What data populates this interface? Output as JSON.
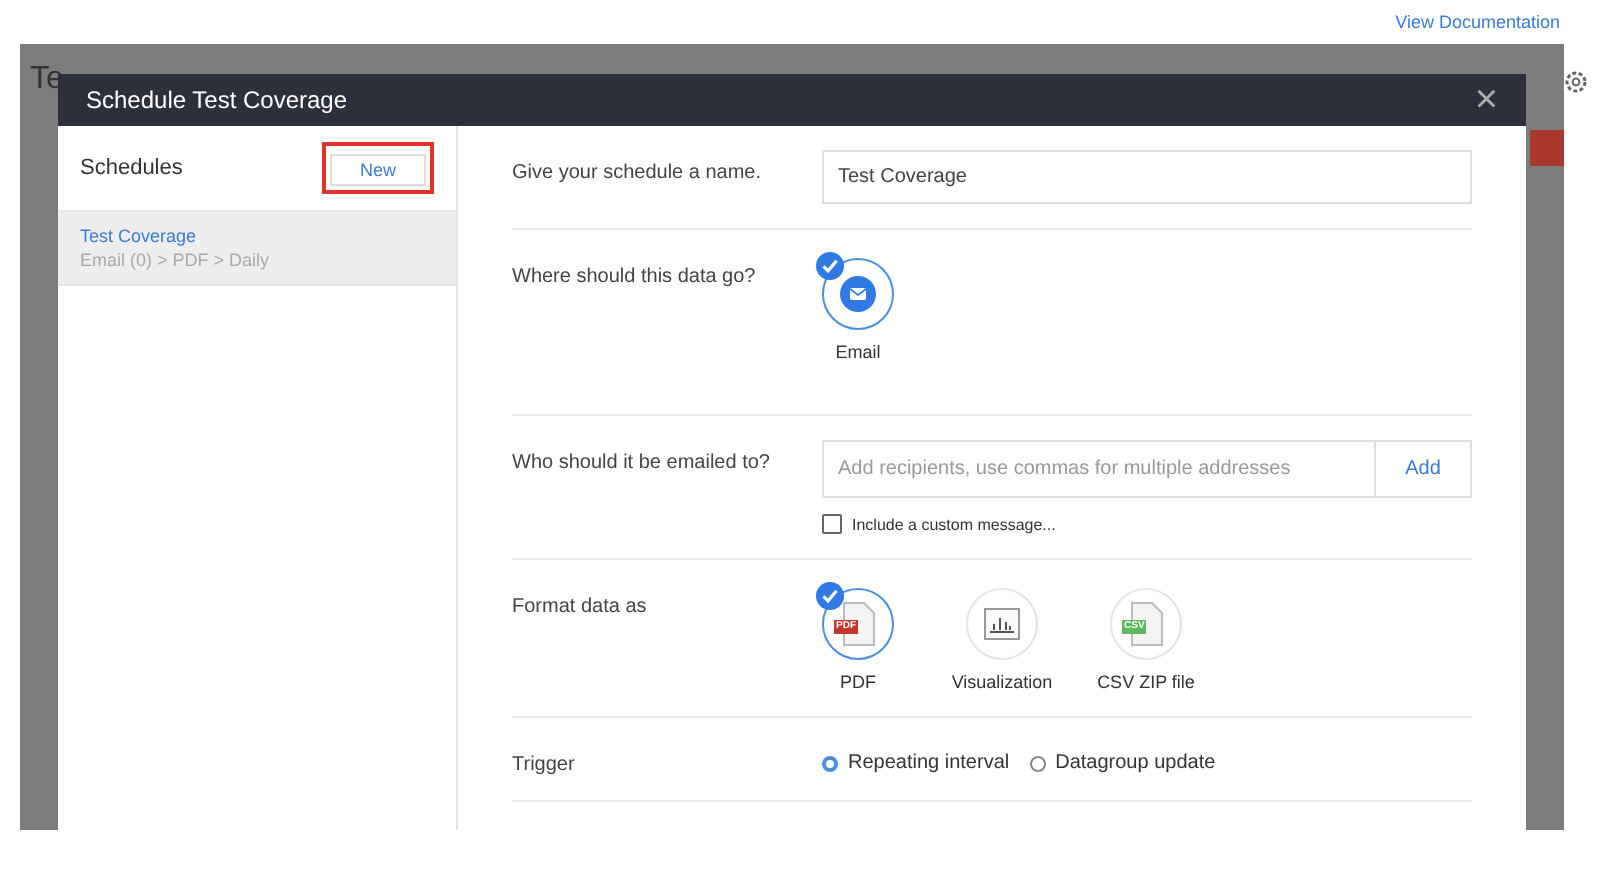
{
  "page": {
    "documentation_link": "View Documentation",
    "background_title": "Te"
  },
  "modal": {
    "title": "Schedule Test Coverage",
    "close": "×"
  },
  "sidebar": {
    "heading": "Schedules",
    "new_button": "New",
    "items": [
      {
        "name": "Test Coverage",
        "summary": "Email (0) > PDF > Daily",
        "selected": true
      }
    ]
  },
  "form": {
    "rows": [
      {
        "kind": "text",
        "label": "Give your schedule a name.",
        "value": "Test Coverage"
      },
      {
        "kind": "tiles",
        "label": "Where should this data go?",
        "options": [
          {
            "kind": "email",
            "label": "Email",
            "selected": true
          }
        ]
      },
      {
        "kind": "recipients",
        "label": "Who should it be emailed to?",
        "placeholder": "Add recipients, use commas for multiple addresses",
        "button": "Add",
        "checkbox": {
          "label": "Include a custom message...",
          "checked": false
        }
      },
      {
        "kind": "tiles",
        "label": "Format data as",
        "options": [
          {
            "kind": "pdf",
            "label": "PDF",
            "badge": "PDF",
            "selected": true
          },
          {
            "kind": "chart",
            "label": "Visualization",
            "selected": false
          },
          {
            "kind": "csv",
            "label": "CSV ZIP file",
            "badge": "CSV",
            "selected": false
          }
        ]
      },
      {
        "kind": "radios",
        "label": "Trigger",
        "options": [
          {
            "label": "Repeating interval",
            "selected": true
          },
          {
            "label": "Datagroup update",
            "selected": false
          }
        ]
      }
    ]
  }
}
